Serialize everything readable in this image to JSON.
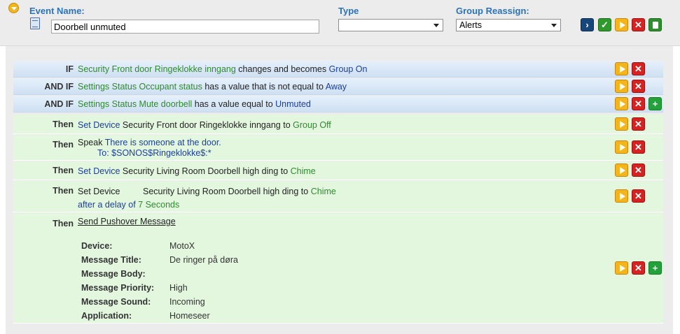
{
  "header": {
    "event_name_label": "Event Name:",
    "event_name_value": "Doorbell unmuted",
    "type_label": "Type",
    "type_value": "",
    "group_label": "Group Reassign:",
    "group_value": "Alerts"
  },
  "conditions": [
    {
      "keyword": "IF",
      "parts": [
        "Security Front door Ringeklokke inngang",
        " changes and becomes ",
        "Group On"
      ]
    },
    {
      "keyword": "AND IF",
      "parts": [
        "Settings Status Occupant status",
        " has a value that is not equal to ",
        "Away"
      ]
    },
    {
      "keyword": "AND IF",
      "parts": [
        "Settings Status Mute doorbell",
        " has a value equal to ",
        "Unmuted"
      ]
    }
  ],
  "actions": {
    "a1": {
      "keyword": "Then",
      "verb": "Set Device",
      "device": " Security Front door Ringeklokke inngang to ",
      "value": "Group Off"
    },
    "a2": {
      "keyword": "Then",
      "verb": "Speak ",
      "text": "There is someone at the door.",
      "to_label": "To: ",
      "to": "$SONOS$Ringeklokke$:*"
    },
    "a3": {
      "keyword": "Then",
      "verb": "Set Device",
      "device": " Security Living Room Doorbell high ding to ",
      "value": "Chime"
    },
    "a4": {
      "keyword": "Then",
      "verb": "Set Device",
      "device": "Security Living Room Doorbell high ding to ",
      "value": "Chime",
      "delay_prefix": "after a delay of ",
      "delay": "7 Seconds"
    },
    "a5": {
      "keyword": "Then",
      "verb": "Send Pushover Message",
      "fields": [
        {
          "label": "Device:",
          "value": "MotoX"
        },
        {
          "label": "Message Title:",
          "value": "De ringer på døra"
        },
        {
          "label": "Message Body:",
          "value": ""
        },
        {
          "label": "Message Priority:",
          "value": "High"
        },
        {
          "label": "Message Sound:",
          "value": "Incoming"
        },
        {
          "label": "Application:",
          "value": "Homeseer"
        }
      ]
    }
  },
  "icons": {
    "collapse": "collapse-arrow-icon",
    "properties": "document-icon",
    "nav": "chevron-right-icon",
    "save": "checkmark-icon",
    "run": "play-icon",
    "delete": "x-icon",
    "add": "plus-icon",
    "copy": "copy-icon"
  },
  "colors": {
    "accent_label": "#2a73b8",
    "device_green": "#2f8a2f",
    "device_blue": "#1c3f9a",
    "button_play": "#f3b51a",
    "button_delete": "#d72222",
    "button_add": "#23a13a"
  }
}
